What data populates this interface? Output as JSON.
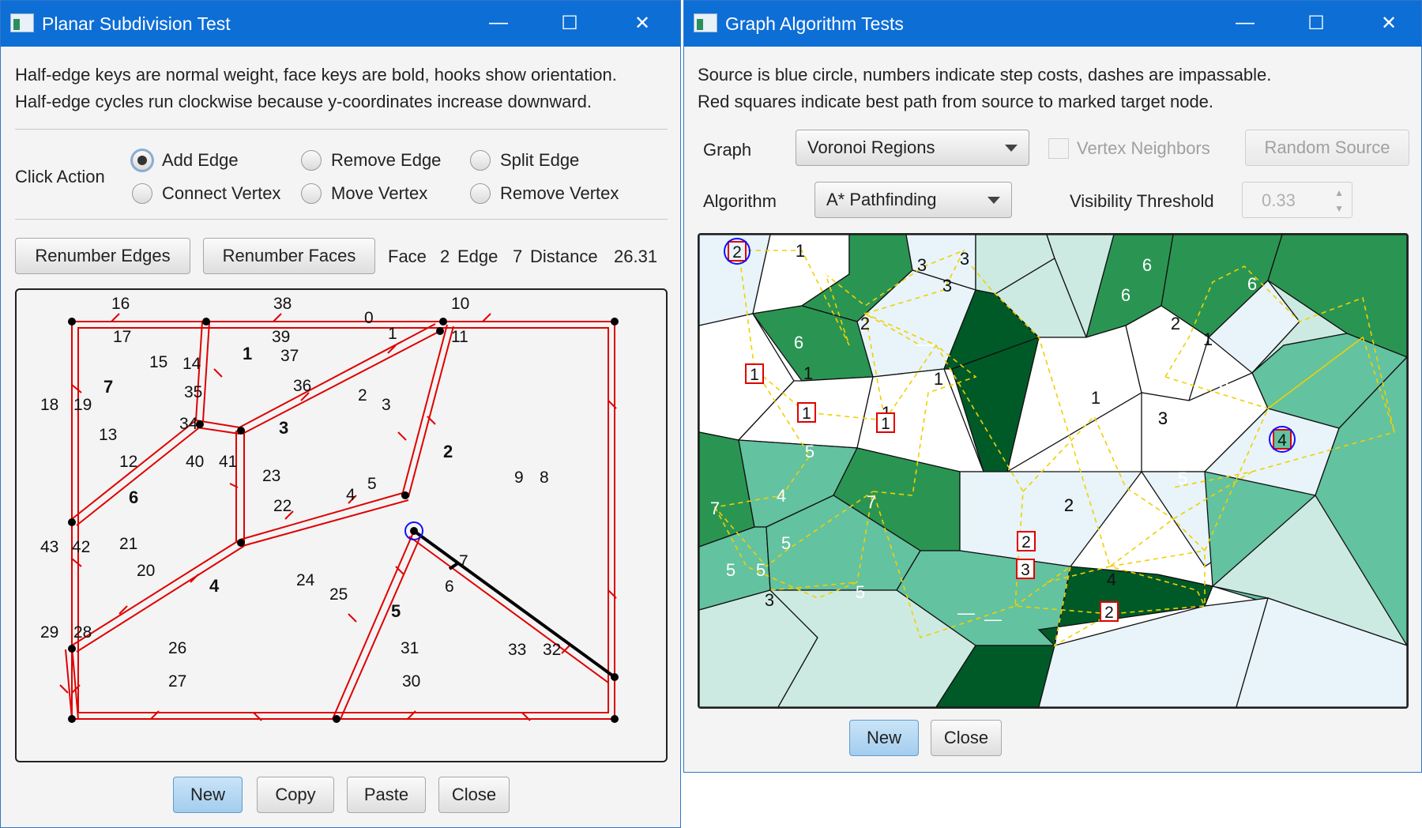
{
  "left_window": {
    "title": "Planar Subdivision Test",
    "caption_buttons": {
      "minimize": "—",
      "maximize": "☐",
      "close": "✕"
    },
    "description": [
      "Half-edge keys are normal weight, face keys are bold, hooks show orientation.",
      "Half-edge cycles run clockwise because y-coordinates increase downward."
    ],
    "click_action_label": "Click Action",
    "radio_options": [
      "Add Edge",
      "Remove Edge",
      "Split Edge",
      "Connect Vertex",
      "Move Vertex",
      "Remove Vertex"
    ],
    "selected_option": "Add Edge",
    "renumber_edges_label": "Renumber Edges",
    "renumber_faces_label": "Renumber Faces",
    "status": {
      "face_label": "Face",
      "face": "2",
      "edge_label": "Edge",
      "edge": "7",
      "distance_label": "Distance",
      "distance": "26.31"
    },
    "canvas": {
      "edge_labels": [
        "16",
        "38",
        "10",
        "0",
        "1",
        "17",
        "39",
        "11",
        "15",
        "14",
        "37",
        "35",
        "36",
        "2",
        "3",
        "18",
        "19",
        "34",
        "13",
        "12",
        "40",
        "41",
        "23",
        "9",
        "8",
        "4",
        "5",
        "22",
        "43",
        "42",
        "21",
        "20",
        "24",
        "7",
        "6",
        "25",
        "29",
        "28",
        "26",
        "31",
        "33",
        "32",
        "27",
        "30"
      ],
      "face_labels": [
        "1",
        "7",
        "3",
        "2",
        "6",
        "4",
        "5"
      ]
    },
    "buttons": {
      "new": "New",
      "copy": "Copy",
      "paste": "Paste",
      "close": "Close"
    }
  },
  "right_window": {
    "title": "Graph Algorithm Tests",
    "caption_buttons": {
      "minimize": "—",
      "maximize": "☐",
      "close": "✕"
    },
    "description": [
      "Source is blue circle, numbers indicate step costs, dashes are impassable.",
      "Red squares indicate best path from source to marked target node."
    ],
    "graph_label": "Graph",
    "graph_value": "Voronoi Regions",
    "vertex_neighbors_label": "Vertex Neighbors",
    "random_source_label": "Random Source",
    "algorithm_label": "Algorithm",
    "algorithm_value": "A* Pathfinding",
    "visibility_label": "Visibility Threshold",
    "visibility_value": "0.33",
    "region_costs": [
      "2",
      "1",
      "6",
      "3",
      "3",
      "3",
      "6",
      "6",
      "6",
      "2",
      "6",
      "—",
      "1",
      "1",
      "2",
      "1",
      "1",
      "1",
      "—",
      "3",
      "5",
      "5",
      "4",
      "7",
      "7",
      "5",
      "5",
      "5",
      "5",
      "2",
      "2",
      "5",
      "3",
      "4",
      "5",
      "3",
      "—",
      "—",
      "2"
    ],
    "path_costs": [
      "2",
      "1",
      "1",
      "1",
      "2",
      "3",
      "2",
      "4"
    ],
    "buttons": {
      "new": "New",
      "close": "Close"
    }
  },
  "colors": {
    "titlebar": "#0d6ed6",
    "edge": "#e00000",
    "highlight_edge": "#000000",
    "source_circle": "#1010ff",
    "path_box": "#e00000",
    "link": "#f0d000",
    "green_dark": "#005a28",
    "green_mid": "#2a8f50",
    "green_light": "#63c2a0"
  }
}
